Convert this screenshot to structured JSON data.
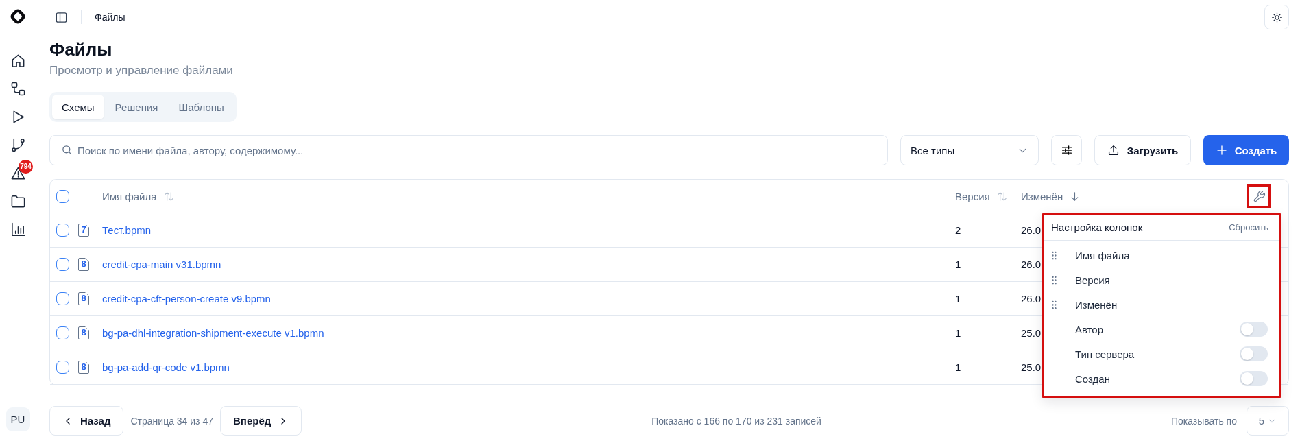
{
  "sidebar": {
    "alert_badge": "794",
    "avatar": "PU"
  },
  "header": {
    "breadcrumb": "Файлы"
  },
  "page": {
    "title": "Файлы",
    "subtitle": "Просмотр и управление файлами"
  },
  "tabs": [
    {
      "label": "Схемы",
      "selected": true
    },
    {
      "label": "Решения",
      "selected": false
    },
    {
      "label": "Шаблоны",
      "selected": false
    }
  ],
  "toolbar": {
    "search": {
      "placeholder": "Поиск по имени файла, автору, содержимому..."
    },
    "type_filter": "Все типы",
    "upload_button": "Загрузить",
    "create_button": "Создать"
  },
  "table": {
    "select_all_checked": false,
    "columns": [
      {
        "label": "Имя файла",
        "sorted": false
      },
      {
        "label": "Версия",
        "sorted": false
      },
      {
        "label": "Изменён",
        "sorted": true,
        "descending": true
      }
    ],
    "settings_button": {
      "highlighted": true
    },
    "rows": [
      {
        "checked": false,
        "type_badge": "7",
        "name": "Тест.bpmn",
        "version": "2",
        "modified": "26.0"
      },
      {
        "checked": false,
        "type_badge": "8",
        "name": "credit-cpa-main v31.bpmn",
        "version": "1",
        "modified": "26.0"
      },
      {
        "checked": false,
        "type_badge": "8",
        "name": "credit-cpa-cft-person-create v9.bpmn",
        "version": "1",
        "modified": "26.0"
      },
      {
        "checked": false,
        "type_badge": "8",
        "name": "bg-pa-dhl-integration-shipment-execute v1.bpmn",
        "version": "1",
        "modified": "25.0"
      },
      {
        "checked": false,
        "type_badge": "8",
        "name": "bg-pa-add-qr-code v1.bpmn",
        "version": "1",
        "modified": "25.0"
      }
    ]
  },
  "column_settings": {
    "highlighted": true,
    "title": "Настройка колонок",
    "reset": "Сбросить",
    "items": [
      {
        "kind": "draggable",
        "label": "Имя файла"
      },
      {
        "kind": "draggable",
        "label": "Версия"
      },
      {
        "kind": "draggable",
        "label": "Изменён"
      },
      {
        "kind": "toggle",
        "label": "Автор",
        "on": false
      },
      {
        "kind": "toggle",
        "label": "Тип сервера",
        "on": false
      },
      {
        "kind": "toggle",
        "label": "Создан",
        "on": false
      }
    ]
  },
  "pagination": {
    "previous": "Назад",
    "page_info": "Страница 34 из 47",
    "next": "Вперёд",
    "summary": "Показано с 166 по 170 из 231 записей",
    "page_size_label": "Показывать по",
    "page_size": "5"
  }
}
